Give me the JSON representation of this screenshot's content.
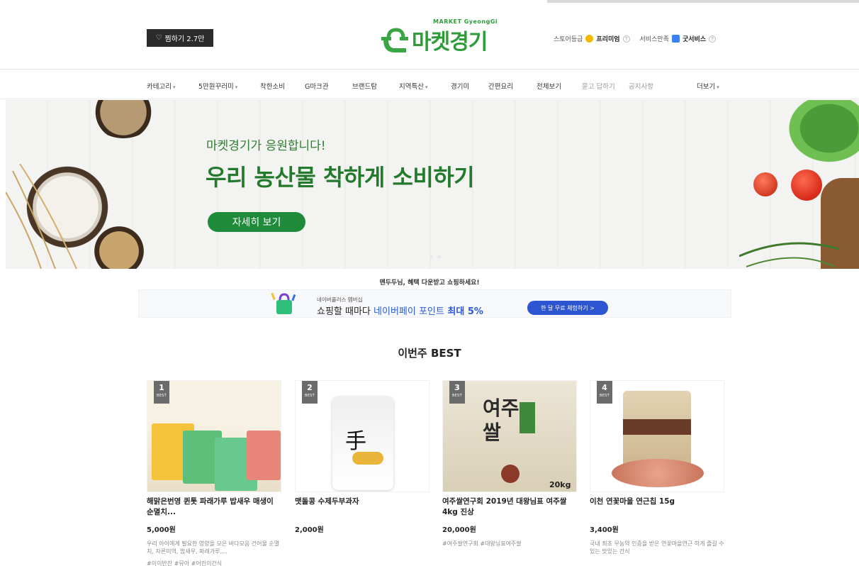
{
  "header": {
    "zzim_label": "찜하기 2.7만",
    "logo_sub": "MARKET GyeongGi",
    "logo_main": "마켓경기",
    "grade": [
      {
        "label": "스토어등급",
        "value": "프리미엄",
        "icon": "crown-icon",
        "color": "#f5b800"
      },
      {
        "label": "서비스만족",
        "value": "굿서비스",
        "icon": "thumbs-up-icon",
        "color": "#3b82f6"
      }
    ]
  },
  "nav": [
    {
      "label": "카테고리",
      "caret": true,
      "muted": false
    },
    {
      "label": "5만원꾸러미",
      "caret": true,
      "muted": false
    },
    {
      "label": "착한소비",
      "caret": false,
      "muted": false
    },
    {
      "label": "G마크관",
      "caret": false,
      "muted": false
    },
    {
      "label": "브랜드탐",
      "caret": false,
      "muted": false
    },
    {
      "label": "지역특산",
      "caret": true,
      "muted": false
    },
    {
      "label": "경기미",
      "caret": false,
      "muted": false
    },
    {
      "label": "간편요리",
      "caret": false,
      "muted": false
    },
    {
      "label": "전체보기",
      "caret": false,
      "muted": false
    },
    {
      "label": "묻고 답하기",
      "caret": false,
      "muted": true
    },
    {
      "label": "공지사항",
      "caret": false,
      "muted": true
    },
    {
      "label": "더보기",
      "caret": true,
      "muted": false
    }
  ],
  "banner": {
    "subtitle": "마켓경기가 응원합니다!",
    "title": "우리 농산물 착하게 소비하기",
    "button": "자세히 보기"
  },
  "promo": {
    "title": "맨두두님, 혜택 다운받고 쇼핑하세요!",
    "small": "네이버플러스 멤버십",
    "main_1": "쇼핑할 때마다 ",
    "main_2": "네이버페이 포인트",
    "main_3": " 최대 5%",
    "button": "한 달 무료 체험하기 >"
  },
  "best": {
    "title": "이번주 BEST",
    "rank_label": "BEST",
    "items": [
      {
        "rank": "1",
        "name": "해맑은번영 퀸톳 파래가루 밥새우 매생이 순멸치...",
        "price": "5,000원",
        "desc": "우리 아이에게 필요한 영양을 모은 바다모음 건어물 순멸치, 자른미역, 밥새우, 파래가루,...",
        "tags": "#이이반찬 #뮤아 #어린이간식"
      },
      {
        "rank": "2",
        "name": "맷돌콩 수제두부과자",
        "price": "2,000원",
        "desc": "",
        "tags": ""
      },
      {
        "rank": "3",
        "name": "여주쌀연구회 2019년 대왕님표 여주쌀 4kg 진상",
        "price": "20,000원",
        "desc": "",
        "tags": "#여주쌀연구회 #대왕님표여주쌀"
      },
      {
        "rank": "4",
        "name": "이천 연꽃마을 연근칩 15g",
        "price": "3,400원",
        "desc": "국내 최초 무농약 인증을 받은 연꽃마을연근 하게 즐길 수 있는 맛있는 간식",
        "tags": ""
      }
    ]
  }
}
